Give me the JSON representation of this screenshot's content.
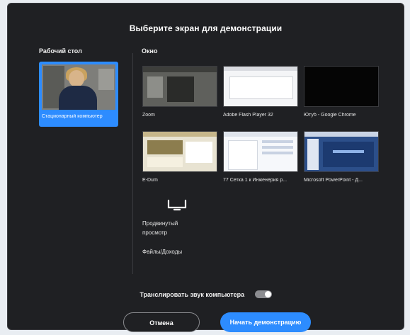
{
  "dialog": {
    "title": "Выберите экран для демонстрации",
    "desktop_section": "Рабочий стол",
    "windows_section": "Окно"
  },
  "desktop": {
    "caption": "Стационарный компьютер",
    "selected": true
  },
  "windows": [
    {
      "label": "Zoom",
      "thumb": "dark"
    },
    {
      "label": "Adobe Flash Player 32",
      "thumb": "white"
    },
    {
      "label": "Ютуб - Google Chrome",
      "thumb": "black"
    },
    {
      "label": "E-Dum",
      "thumb": "doc"
    },
    {
      "label": "77 Сетка 1 к Инженерия р...",
      "thumb": "explorer"
    },
    {
      "label": "Microsoft PowerPoint - Д...",
      "thumb": "powerpoint"
    }
  ],
  "other": {
    "secondary_label_line1": "Продвинутый",
    "secondary_label_line2": "просмотр",
    "files_label": "Файлы/Доходы"
  },
  "audio": {
    "label": "Транслировать звук компьютера",
    "enabled": true
  },
  "buttons": {
    "cancel": "Отмена",
    "start": "Начать демонстрацию"
  },
  "colors": {
    "accent": "#2d8cff",
    "dialog_bg": "#1f2023"
  }
}
